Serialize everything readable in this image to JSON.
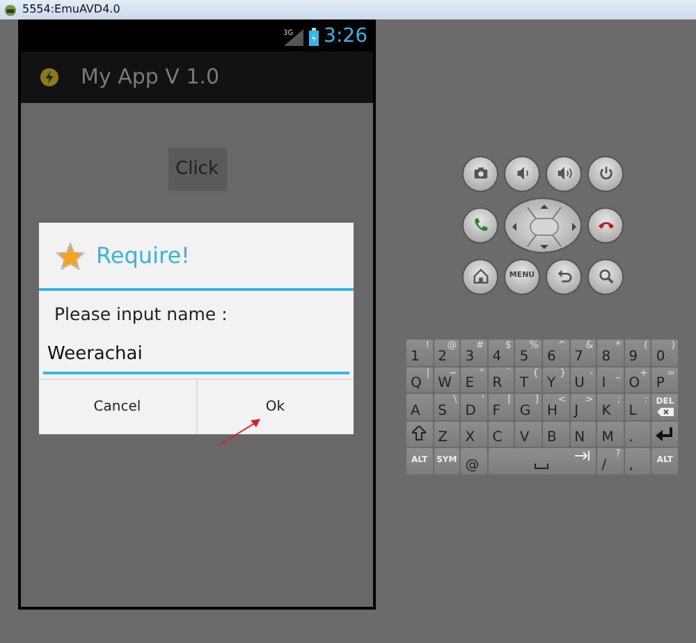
{
  "window": {
    "title": "5554:EmuAVD4.0"
  },
  "status_bar": {
    "network": "3G",
    "time": "3:26"
  },
  "action_bar": {
    "title": "My App V 1.0"
  },
  "content": {
    "button": "Click"
  },
  "dialog": {
    "title": "Require!",
    "message": "Please input name :",
    "input": {
      "value": "Weerachai",
      "focused": true
    },
    "buttons": [
      {
        "label": "Cancel"
      },
      {
        "label": "Ok"
      }
    ]
  },
  "hardware_keys": {
    "menu_label": "MENU"
  },
  "keyboard": {
    "number_row": [
      {
        "kind": "char",
        "main": "1",
        "alt": "!"
      },
      {
        "kind": "char",
        "main": "2",
        "alt": "@"
      },
      {
        "kind": "char",
        "main": "3",
        "alt": "#"
      },
      {
        "kind": "char",
        "main": "4",
        "alt": "$"
      },
      {
        "kind": "char",
        "main": "5",
        "alt": "%"
      },
      {
        "kind": "char",
        "main": "6",
        "alt": "^"
      },
      {
        "kind": "char",
        "main": "7",
        "alt": "&"
      },
      {
        "kind": "char",
        "main": "8",
        "alt": "*"
      },
      {
        "kind": "char",
        "main": "9",
        "alt": "("
      },
      {
        "kind": "char",
        "main": "0",
        "alt": ")"
      }
    ],
    "upper_row": [
      {
        "kind": "char",
        "main": "Q",
        "alt": "|"
      },
      {
        "kind": "char",
        "main": "W",
        "alt": "~"
      },
      {
        "kind": "char",
        "main": "E",
        "alt": "\""
      },
      {
        "kind": "char",
        "main": "R",
        "alt": "`"
      },
      {
        "kind": "char",
        "main": "T",
        "alt": "{"
      },
      {
        "kind": "char",
        "main": "Y",
        "alt": "}"
      },
      {
        "kind": "char",
        "main": "U",
        "alt": "-"
      },
      {
        "kind": "char",
        "main": "I",
        "alt": "_"
      },
      {
        "kind": "char",
        "main": "O",
        "alt": "+"
      },
      {
        "kind": "char",
        "main": "P",
        "alt": "="
      }
    ],
    "middle_row": [
      {
        "kind": "char",
        "main": "A"
      },
      {
        "kind": "char",
        "main": "S",
        "alt": "\\"
      },
      {
        "kind": "char",
        "main": "D",
        "alt": "'"
      },
      {
        "kind": "char",
        "main": "F",
        "alt": "["
      },
      {
        "kind": "char",
        "main": "G",
        "alt": "]"
      },
      {
        "kind": "char",
        "main": "H",
        "alt": "<"
      },
      {
        "kind": "char",
        "main": "J",
        "alt": ">"
      },
      {
        "kind": "char",
        "main": "K",
        "alt": ";"
      },
      {
        "kind": "char",
        "main": "L",
        "alt": ":"
      },
      {
        "kind": "del",
        "main": "DEL"
      }
    ],
    "lower_row": [
      {
        "kind": "shift"
      },
      {
        "kind": "char",
        "main": "Z"
      },
      {
        "kind": "char",
        "main": "X"
      },
      {
        "kind": "char",
        "main": "C"
      },
      {
        "kind": "char",
        "main": "V"
      },
      {
        "kind": "char",
        "main": "B"
      },
      {
        "kind": "char",
        "main": "N"
      },
      {
        "kind": "char",
        "main": "M"
      },
      {
        "kind": "char",
        "main": "."
      },
      {
        "kind": "enter"
      }
    ],
    "bottom_row": [
      {
        "kind": "small",
        "main": "ALT"
      },
      {
        "kind": "small",
        "main": "SYM"
      },
      {
        "kind": "char",
        "main": "@"
      },
      {
        "kind": "space"
      },
      {
        "kind": "char",
        "main": "/",
        "alt": "?"
      },
      {
        "kind": "char",
        "main": ","
      },
      {
        "kind": "small",
        "main": "ALT"
      }
    ]
  }
}
